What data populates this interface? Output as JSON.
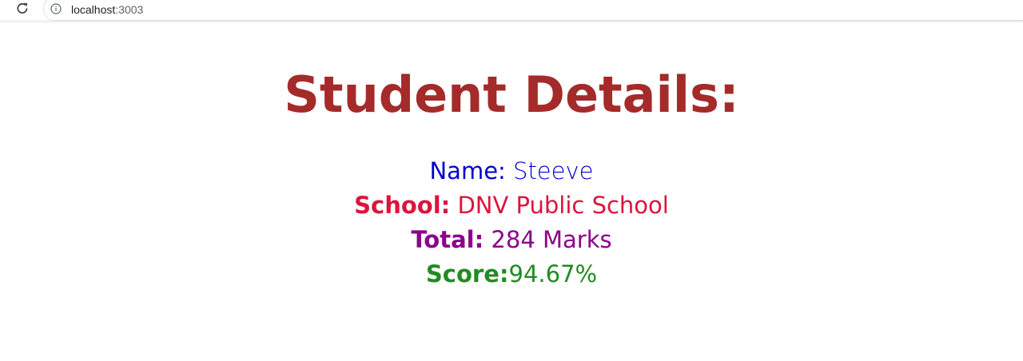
{
  "browser": {
    "url_host": "localhost",
    "url_port": ":3003"
  },
  "page": {
    "title": "Student Details:",
    "title_color": "#a52a2a",
    "details": [
      {
        "label": "Name:",
        "value": " Steeve",
        "color": "#0000cd",
        "label_bold": false
      },
      {
        "label": "School:",
        "value": " DNV Public School",
        "color": "#dc143c",
        "label_bold": true
      },
      {
        "label": "Total:",
        "value": " 284 Marks",
        "color": "#8b008b",
        "label_bold": true
      },
      {
        "label": "Score:",
        "value": "94.67%",
        "color": "#228b22",
        "label_bold": true
      }
    ]
  }
}
